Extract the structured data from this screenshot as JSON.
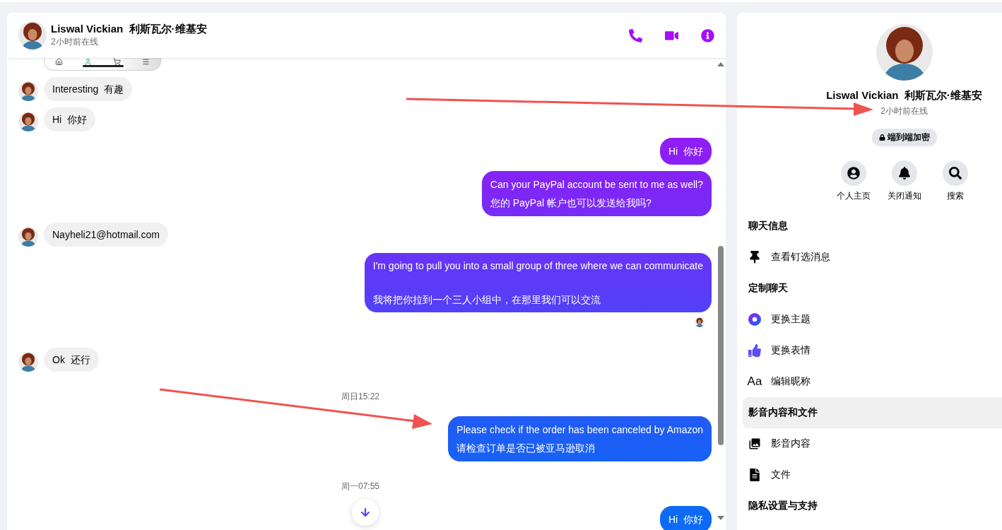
{
  "chat_header": {
    "name": "Liswal Vickian  利斯瓦尔·维基安",
    "status": "2小时前在线"
  },
  "messages": [
    {
      "kind": "image"
    },
    {
      "kind": "incoming",
      "lines": [
        "Interesting  有趣"
      ]
    },
    {
      "kind": "incoming",
      "lines": [
        "Hi  你好"
      ]
    },
    {
      "kind": "outgoing",
      "lines": [
        "Hi  你好"
      ],
      "seen": false
    },
    {
      "kind": "outgoing",
      "lines": [
        "Can your PayPal account be sent to me as well?",
        "您的 PayPal 帐户也可以发送给我吗?"
      ],
      "spaced": false,
      "seen": false
    },
    {
      "kind": "incoming",
      "lines": [
        "Nayheli21@hotmail.com"
      ]
    },
    {
      "kind": "outgoing",
      "lines": [
        "I'm going to pull you into a small group of three where we can communicate",
        "我将把你拉到一个三人小组中，在那里我们可以交流"
      ],
      "spaced": true,
      "seen": true
    },
    {
      "kind": "incoming",
      "lines": [
        "Ok  还行"
      ]
    },
    {
      "kind": "time",
      "lines": [
        "周日15:22"
      ]
    },
    {
      "kind": "outgoing",
      "lines": [
        "Please check if the order has been canceled by Amazon",
        "请检查订单是否已被亚马逊取消"
      ],
      "spaced": false,
      "seen": false
    },
    {
      "kind": "time",
      "lines": [
        "周一07:55"
      ]
    },
    {
      "kind": "outgoing",
      "lines": [
        "Hi  你好"
      ],
      "seen": false
    }
  ],
  "profile": {
    "name": "Liswal Vickian  利斯瓦尔·维基安",
    "status": "2小时前在线",
    "encryption": "端到端加密",
    "actions": [
      "个人主页",
      "关闭通知",
      "搜索"
    ]
  },
  "sections": [
    {
      "kind": "header",
      "label": "聊天信息",
      "selected": false
    },
    {
      "kind": "item",
      "label": "查看钉选消息",
      "selected": false
    },
    {
      "kind": "header",
      "label": "定制聊天",
      "selected": false
    },
    {
      "kind": "item",
      "label": "更换主题",
      "selected": false
    },
    {
      "kind": "item",
      "label": "更换表情",
      "selected": false
    },
    {
      "kind": "item",
      "label": "编辑昵称",
      "icon_text": "Aa",
      "selected": false
    },
    {
      "kind": "header",
      "label": "影音内容和文件",
      "selected": true
    },
    {
      "kind": "item",
      "label": "影音内容",
      "selected": false
    },
    {
      "kind": "item",
      "label": "文件",
      "selected": false
    },
    {
      "kind": "header",
      "label": "隐私设置与支持",
      "selected": false
    }
  ]
}
